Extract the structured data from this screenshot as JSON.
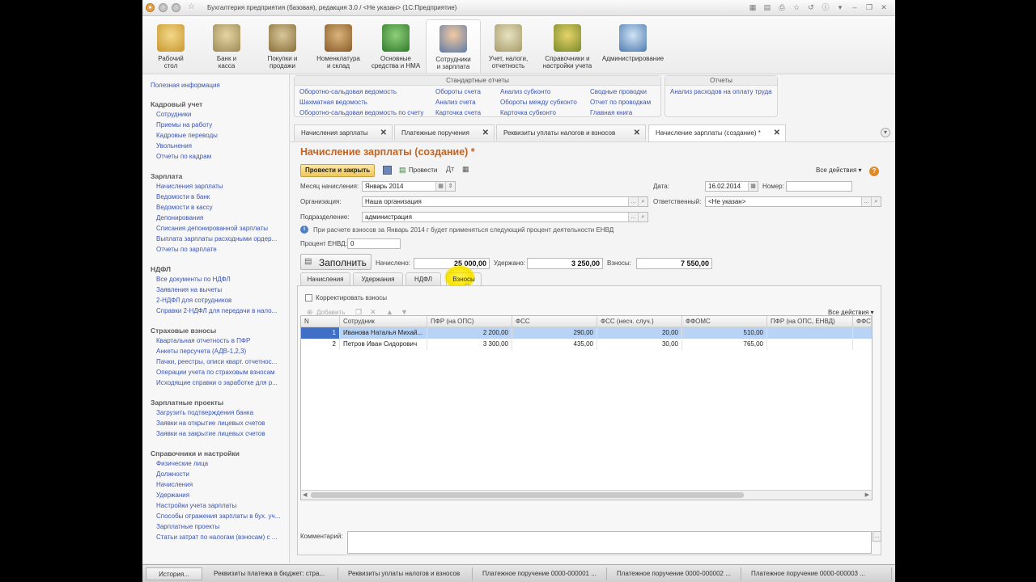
{
  "window": {
    "title": "Бухгалтерия предприятия (базовая), редакция 3.0 / <Не указан>  (1С:Предприятие)"
  },
  "ribbon": {
    "sections": [
      {
        "label": "Рабочий стол",
        "line1": "Рабочий",
        "line2": "стол"
      },
      {
        "label": "Банк и касса",
        "line1": "Банк и",
        "line2": "касса"
      },
      {
        "label": "Покупки и продажи",
        "line1": "Покупки и",
        "line2": "продажи"
      },
      {
        "label": "Номенклатура и склад",
        "line1": "Номенклатура",
        "line2": "и склад"
      },
      {
        "label": "Основные средства и НМА",
        "line1": "Основные",
        "line2": "средства и НМА"
      },
      {
        "label": "Сотрудники и зарплата",
        "line1": "Сотрудники",
        "line2": "и зарплата"
      },
      {
        "label": "Учет, налоги, отчетность",
        "line1": "Учет, налоги,",
        "line2": "отчетность"
      },
      {
        "label": "Справочники и настройки учета",
        "line1": "Справочники и",
        "line2": "настройки учета"
      },
      {
        "label": "Администрирование",
        "line1": "Администрирование",
        "line2": ""
      }
    ]
  },
  "sidebar": {
    "top_link": "Полезная информация",
    "groups": [
      {
        "title": "Кадровый учет",
        "items": [
          "Сотрудники",
          "Приемы на работу",
          "Кадровые переводы",
          "Увольнения",
          "Отчеты по кадрам"
        ]
      },
      {
        "title": "Зарплата",
        "items": [
          "Начисления зарплаты",
          "Ведомости в банк",
          "Ведомости в кассу",
          "Депонирования",
          "Списания депонированной зарплаты",
          "Выплата зарплаты расходными ордер...",
          "Отчеты по зарплате"
        ]
      },
      {
        "title": "НДФЛ",
        "items": [
          "Все документы по НДФЛ",
          "Заявления на вычеты",
          "2-НДФЛ для сотрудников",
          "Справки 2-НДФЛ для передачи в нало..."
        ]
      },
      {
        "title": "Страховые взносы",
        "items": [
          "Квартальная отчетность в ПФР",
          "Анкеты персучета (АДВ-1,2,3)",
          "Пачки, реестры, описи кварт. отчетнос...",
          "Операции учета по страховым взносам",
          "Исходящие справки о заработке для р..."
        ]
      },
      {
        "title": "Зарплатные проекты",
        "items": [
          "Загрузить подтверждения банка",
          "Заявки на открытие лицевых счетов",
          "Заявки на закрытие лицевых счетов"
        ]
      },
      {
        "title": "Справочники и настройки",
        "items": [
          "Физические лица",
          "Должности",
          "Начисления",
          "Удержания",
          "Настройки учета зарплаты",
          "Способы отражения зарплаты в бух. уч...",
          "Зарплатные проекты",
          "Статьи затрат по налогам (взносам) с ..."
        ]
      }
    ]
  },
  "standard_reports": {
    "title": "Стандартные отчеты",
    "col1": [
      "Оборотно-сальдовая ведомость",
      "Шахматная ведомость",
      "Оборотно-сальдовая ведомость по счету"
    ],
    "col2": [
      "Обороты счета",
      "Анализ счета",
      "Карточка счета"
    ],
    "col3": [
      "Анализ субконто",
      "Обороты между субконто",
      "Карточка субконто"
    ],
    "col4": [
      "Сводные проводки",
      "Отчет по проводкам",
      "Главная книга"
    ]
  },
  "reports": {
    "title": "Отчеты",
    "items": [
      "Анализ расходов на оплату труда"
    ]
  },
  "tabs": [
    {
      "label": "Начисления зарплаты"
    },
    {
      "label": "Платежные поручения"
    },
    {
      "label": "Реквизиты уплаты налогов и взносов"
    },
    {
      "label": "Начисление зарплаты (создание) *"
    }
  ],
  "form": {
    "title": "Начисление зарплаты (создание) *",
    "toolbar": {
      "post_close": "Провести и закрыть",
      "post": "Провести",
      "all_actions": "Все действия"
    },
    "month_label": "Месяц начисления:",
    "month_value": "Январь 2014",
    "date_label": "Дата:",
    "date_value": "16.02.2014",
    "number_label": "Номер:",
    "number_value": "",
    "org_label": "Организация:",
    "org_value": "Наша организация",
    "resp_label": "Ответственный:",
    "resp_value": "<Не указан>",
    "dept_label": "Подразделение:",
    "dept_value": "администрация",
    "info_text": "При расчете взносов за Январь 2014 г будет применяться следующий процент деятельности ЕНВД",
    "envd_label": "Процент ЕНВД:",
    "envd_value": "0",
    "fill_button": "Заполнить",
    "accrued_label": "Начислено:",
    "accrued_value": "25 000,00",
    "withheld_label": "Удержано:",
    "withheld_value": "3 250,00",
    "contrib_label": "Взносы:",
    "contrib_value": "7 550,00",
    "inner_tabs": [
      "Начисления",
      "Удержания",
      "НДФЛ",
      "Взносы"
    ],
    "active_inner_tab": "Взносы",
    "adjust_checkbox": "Корректировать взносы",
    "grid_toolbar": {
      "add": "Добавить",
      "all_actions": "Все действия"
    },
    "comment_label": "Комментарий:",
    "comment_value": ""
  },
  "grid": {
    "columns": [
      "N",
      "Сотрудник",
      "ПФР (на ОПС)",
      "ФСС",
      "ФСС (несч. случ.)",
      "ФФОМС",
      "ПФР (на ОПС, ЕНВД)",
      "ФФС"
    ],
    "rows": [
      {
        "n": "1",
        "employee": "Иванова  Наталья Михай...",
        "pfr": "2 200,00",
        "fss": "290,00",
        "fss_ns": "20,00",
        "ffoms": "510,00",
        "pfr_envd": ""
      },
      {
        "n": "2",
        "employee": "Петров Иван Сидорович",
        "pfr": "3 300,00",
        "fss": "435,00",
        "fss_ns": "30,00",
        "ffoms": "765,00",
        "pfr_envd": ""
      }
    ],
    "selected_row": 0
  },
  "taskbar": {
    "history": "История...",
    "items": [
      "Реквизиты платежа в бюджет: стра...",
      "Реквизиты уплаты налогов и взносов",
      "Платежное поручение 0000-000001 ...",
      "Платежное поручение 0000-000002 ...",
      "Платежное поручение 0000-000003 ..."
    ]
  },
  "colors": {
    "accent": "#c8611d",
    "link": "#3b55b0",
    "selection": "#b8d3f5",
    "highlight": "#f5e300"
  }
}
